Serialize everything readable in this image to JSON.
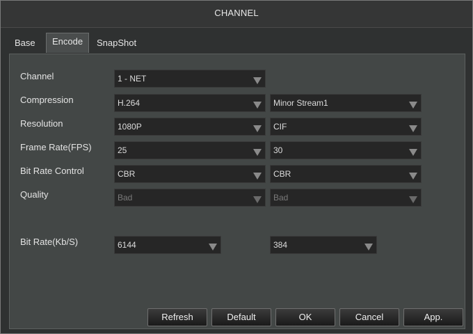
{
  "window": {
    "title": "CHANNEL"
  },
  "tabs": [
    {
      "label": "Base",
      "active": false
    },
    {
      "label": "Encode",
      "active": true
    },
    {
      "label": "SnapShot",
      "active": false
    }
  ],
  "form": {
    "channel": {
      "label": "Channel",
      "value": "1 - NET"
    },
    "compression": {
      "label": "Compression",
      "main": "H.264",
      "sub": "Minor Stream1"
    },
    "resolution": {
      "label": "Resolution",
      "main": "1080P",
      "sub": "CIF"
    },
    "frame_rate": {
      "label": "Frame Rate(FPS)",
      "main": "25",
      "sub": "30"
    },
    "bit_rate_control": {
      "label": "Bit Rate Control",
      "main": "CBR",
      "sub": "CBR"
    },
    "quality": {
      "label": "Quality",
      "main": "Bad",
      "sub": "Bad"
    },
    "bit_rate": {
      "label": "Bit Rate(Kb/S)",
      "main": "6144",
      "sub": "384"
    }
  },
  "buttons": {
    "refresh": "Refresh",
    "default": "Default",
    "ok": "OK",
    "cancel": "Cancel",
    "apply": "App."
  },
  "icons": {
    "dropdown": "triangle-down-icon"
  },
  "colors": {
    "panel": "#434746",
    "field": "#262626",
    "text": "#e4e4e4",
    "disabled_text": "#7a7a7a"
  }
}
